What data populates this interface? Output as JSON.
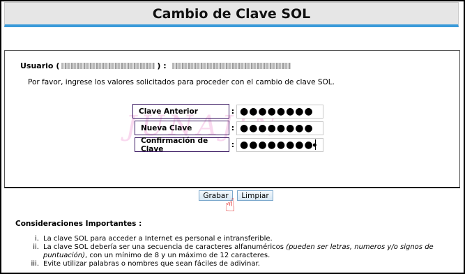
{
  "title": "Cambio de Clave SOL",
  "user": {
    "label": "Usuario (",
    "mid": ") :",
    "redacted": true
  },
  "instruction": "Por favor, ingrese los valores solicitados para proceder con el cambio de clave SOL.",
  "fields": [
    {
      "label": "Clave Anterior",
      "value": "●●●●●●●●"
    },
    {
      "label": "Nueva Clave",
      "value": "●●●●●●●●"
    },
    {
      "label": "Confirmación de Clave",
      "value": "●●●●●●●●"
    }
  ],
  "colon": ":",
  "watermark": "JUNAJIN",
  "buttons": {
    "save": "Grabar",
    "clear": "Limpiar"
  },
  "considerations": {
    "title": "Consideraciones Importantes :",
    "items": [
      {
        "num": "i.",
        "text": "La clave SOL para acceder a Internet es personal e intransferible."
      },
      {
        "num": "ii.",
        "text_a": "La clave SOL debería ser una secuencia de caracteres alfanuméricos ",
        "italic": "(pueden ser letras, numeros y/o signos de puntuación)",
        "text_b": ", con un mínimo de 8 y un máximo de 12 caracteres."
      },
      {
        "num": "iii.",
        "text": "Evite utilizar palabras o nombres que sean fáciles de adivinar."
      }
    ]
  },
  "icons": {
    "eye": "eye-icon",
    "hand": "pointing-hand-icon"
  },
  "colors": {
    "accent": "#3a9ad9",
    "label_border": "#3b1a63",
    "watermark": "#ec8ccd"
  }
}
